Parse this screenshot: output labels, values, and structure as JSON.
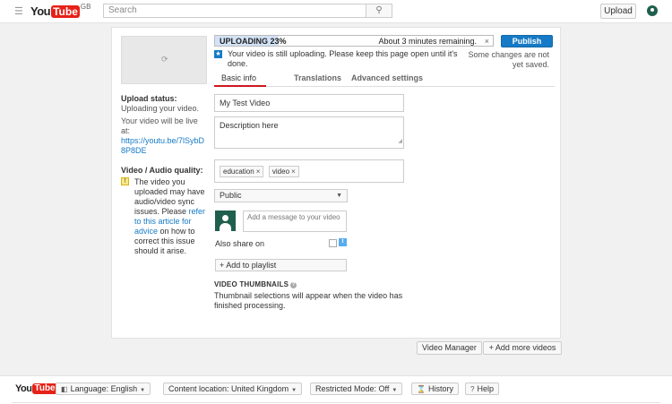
{
  "masthead": {
    "logo_you": "You",
    "logo_tube": "Tube",
    "country": "GB",
    "search_placeholder": "Search",
    "upload_label": "Upload"
  },
  "upload": {
    "progress_label": "UPLOADING 23%",
    "progress_value": 0.23,
    "time_remaining": "About 3 minutes remaining.",
    "close_symbol": "×",
    "publish_label": "Publish",
    "status_message": "Your video is still uploading. Please keep this page open until it's done.",
    "unsaved_message": "Some changes are not yet saved."
  },
  "tabs": [
    {
      "label": "Basic info",
      "active": true
    },
    {
      "label": "Translations",
      "active": false
    },
    {
      "label": "Advanced settings",
      "active": false
    }
  ],
  "left": {
    "upload_status_heading": "Upload status:",
    "upload_status_text": "Uploading your video.",
    "live_at_text": "Your video will be live at:",
    "video_link": "https://youtu.be/7lSybD8P8DE",
    "quality_heading": "Video / Audio quality:",
    "warning_pre": "The video you uploaded may have audio/video sync issues. Please ",
    "warning_link": "refer to this article for advice",
    "warning_post": " on how to correct this issue should it arise."
  },
  "form": {
    "title_value": "My Test Video",
    "description_value": "Description here",
    "tags": [
      "education",
      "video"
    ],
    "privacy_value": "Public",
    "share_message_placeholder": "Add a message to your video",
    "also_share_label": "Also share on",
    "add_to_playlist_label": "+ Add to playlist",
    "thumbnails_heading": "VIDEO THUMBNAILS",
    "thumbnails_message": "Thumbnail selections will appear when the video has finished processing."
  },
  "actions": {
    "video_manager_label": "Video Manager",
    "add_more_videos_label": "+ Add more videos"
  },
  "footer": {
    "logo_you": "You",
    "logo_tube": "Tube",
    "language_label": "Language: English",
    "content_location_label": "Content location: United Kingdom",
    "restricted_mode_label": "Restricted Mode: Off",
    "history_label": "History",
    "help_label": "Help"
  },
  "colors": {
    "brand_red": "#e62117",
    "publish_blue": "#167ac6",
    "link_blue": "#167ac6",
    "active_tab_underline": "#cc181e"
  }
}
